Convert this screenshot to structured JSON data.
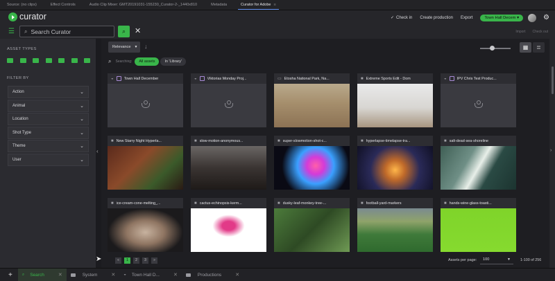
{
  "premiere_tabs": [
    {
      "label": "Source: (no clips)",
      "active": false
    },
    {
      "label": "Effect Controls",
      "active": false
    },
    {
      "label": "Audio Clip Mixer: GMT20191031-155230_Curator-2-_1440x810",
      "active": false
    },
    {
      "label": "Metadata",
      "active": false
    },
    {
      "label": "Curator for Adobe",
      "active": true
    }
  ],
  "header": {
    "app_name": "curator",
    "check_in": "Check in",
    "create_production": "Create production",
    "export": "Export",
    "production": "Town Hall Decem"
  },
  "search": {
    "placeholder": "Search Curator",
    "import_label": "Import",
    "check_out_label": "Check out"
  },
  "sidebar": {
    "asset_types_title": "ASSET TYPES",
    "asset_type_icons": [
      "video-icon",
      "audio-icon",
      "audio-icon",
      "bookmark-icon",
      "film-icon",
      "production-icon",
      "folder-icon"
    ],
    "filter_by_title": "FILTER BY",
    "filters": [
      "Action",
      "Animal",
      "Location",
      "Shot Type",
      "Theme",
      "User"
    ]
  },
  "toolbar": {
    "sort": "Relevance",
    "searching_label": "Searching:",
    "scope_all": "All assets",
    "scope_library": "In 'Library'"
  },
  "assets": [
    {
      "title": "Town Hall December",
      "kind": "production",
      "thumb": "placeholder"
    },
    {
      "title": "Viktorias Monday Proj...",
      "kind": "production",
      "thumb": "placeholder"
    },
    {
      "title": "Etosha National Park, Na...",
      "kind": "image",
      "thumb": "savanna"
    },
    {
      "title": "Extreme Sports Edit - Dom",
      "kind": "video",
      "thumb": "atv"
    },
    {
      "title": "IPV Chris Test Produc...",
      "kind": "production",
      "thumb": "placeholder"
    },
    {
      "title": "New Starry Night Hyperla...",
      "kind": "video",
      "thumb": "canyon"
    },
    {
      "title": "slow-motion-anonymous...",
      "kind": "video",
      "thumb": "crowd"
    },
    {
      "title": "super-slowmotion-shot-c...",
      "kind": "video",
      "thumb": "powder"
    },
    {
      "title": "hyperlapse-timelapse-tra...",
      "kind": "video",
      "thumb": "highway"
    },
    {
      "title": "salt-dead-sea-shoreline",
      "kind": "video",
      "thumb": "shore"
    },
    {
      "title": "ice-cream-cone-melting_...",
      "kind": "video",
      "thumb": "icecream"
    },
    {
      "title": "cactus-echinopsis-kerm...",
      "kind": "video",
      "thumb": "cactus"
    },
    {
      "title": "dusky-leaf-monkey-tree-...",
      "kind": "video",
      "thumb": "monkey"
    },
    {
      "title": "football-yard-markers",
      "kind": "video",
      "thumb": "field"
    },
    {
      "title": "hands-wine-glass-toasti...",
      "kind": "video",
      "thumb": "greenscreen"
    }
  ],
  "pagination": {
    "pages": [
      "1",
      "2",
      "3"
    ],
    "current": "1",
    "assets_per_page_label": "Assets per page:",
    "per_page": "100",
    "range": "1-100 of 256"
  },
  "bottom_tabs": [
    {
      "label": "Search",
      "active": true
    },
    {
      "label": "System",
      "active": false
    },
    {
      "label": "Town Hall D...",
      "active": false
    },
    {
      "label": "Productions",
      "active": false
    }
  ],
  "colors": {
    "accent": "#39b54a",
    "background": "#1e1e22",
    "sidebar": "#2b2b30",
    "card": "#2d2d32"
  }
}
